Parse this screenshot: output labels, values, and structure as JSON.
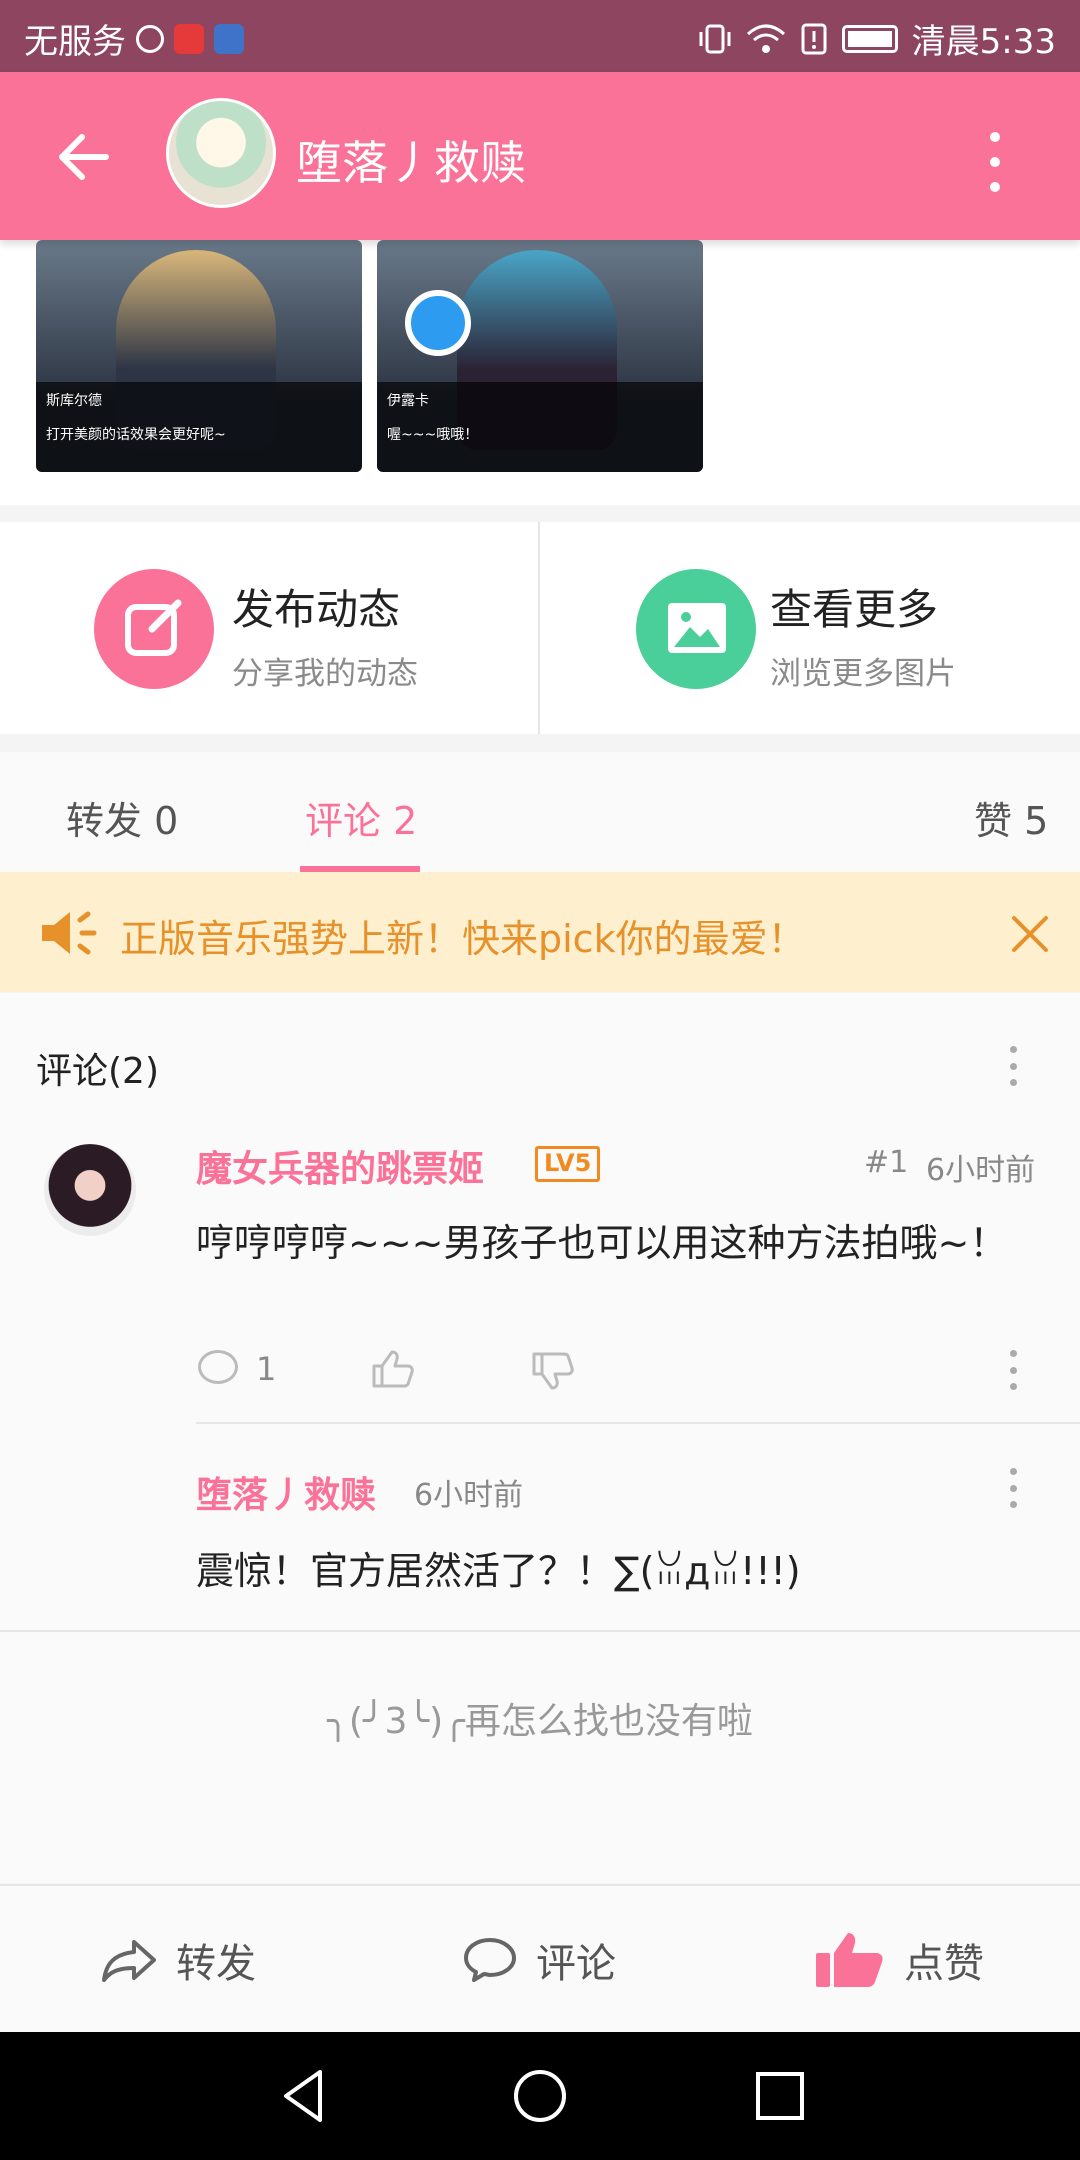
{
  "status_bar": {
    "carrier": "无服务",
    "time": "清晨5:33"
  },
  "header": {
    "title": "堕落丿救赎"
  },
  "gallery": {
    "cards": [
      {
        "name": "斯库尔德",
        "text": "打开美颜的话效果会更好呢~"
      },
      {
        "name": "伊露卡",
        "text": "喔~~~哦哦！"
      }
    ]
  },
  "actions": {
    "post": {
      "title": "发布动态",
      "subtitle": "分享我的动态"
    },
    "more": {
      "title": "查看更多",
      "subtitle": "浏览更多图片"
    }
  },
  "tabs": {
    "repost": "转发 0",
    "comments": "评论 2",
    "likes": "赞 5"
  },
  "notice": {
    "text": "正版音乐强势上新！快来pick你的最爱！"
  },
  "comments": {
    "title": "评论(2)",
    "items": [
      {
        "user": "魔女兵器的跳票姬",
        "level": "LV5",
        "floor": "#1",
        "time": "6小时前",
        "text": "哼哼哼哼~~~男孩子也可以用这种方法拍哦~！",
        "reply_count": "1",
        "reply": {
          "user": "堕落丿救赎",
          "time": "6小时前",
          "text": "震惊！官方居然活了？！∑(ꈍдꈍ!!!)"
        }
      }
    ],
    "end_text": "╮(╯3╰)╭再怎么找也没有啦"
  },
  "bottom_bar": {
    "repost": "转发",
    "comment": "评论",
    "like": "点赞"
  },
  "colors": {
    "brand_pink": "#fb7299",
    "status_bar": "#8e4560",
    "notice_bg": "#fef0cf",
    "notice_text": "#e7912b",
    "level_orange": "#f28a21",
    "action_green": "#4bcf9a"
  }
}
